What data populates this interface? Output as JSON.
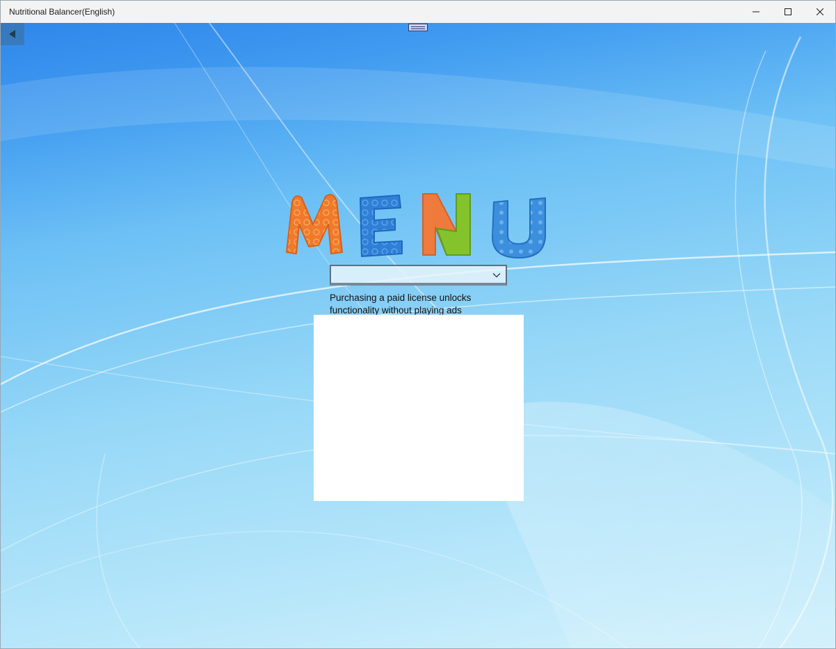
{
  "window": {
    "title": "Nutritional Balancer(English)"
  },
  "titlebar": {
    "minimize_icon": "minimize-icon",
    "maximize_icon": "maximize-icon",
    "close_icon": "close-icon"
  },
  "nav": {
    "back_icon": "back-arrow-icon",
    "handle_icon": "drag-handle-icon"
  },
  "logo": {
    "text": "MENU",
    "letters": [
      {
        "char": "M",
        "color": "#f07a2a"
      },
      {
        "char": "E",
        "color": "#2f7fd6"
      },
      {
        "char": "N",
        "color": "#e8763a",
        "color2": "#7cbf2a"
      },
      {
        "char": "U",
        "color": "#3c8fdc"
      }
    ]
  },
  "menu_select": {
    "selected_value": "",
    "chevron_icon": "chevron-down-icon"
  },
  "license": {
    "text_line1": "Purchasing a paid license unlocks",
    "text_line2": "functionality without playing ads"
  },
  "colors": {
    "titlebar_bg": "#f3f3f3",
    "background_top": "#2f86ea",
    "background_bottom": "#d3f1fc",
    "ad_area": "#ffffff"
  }
}
